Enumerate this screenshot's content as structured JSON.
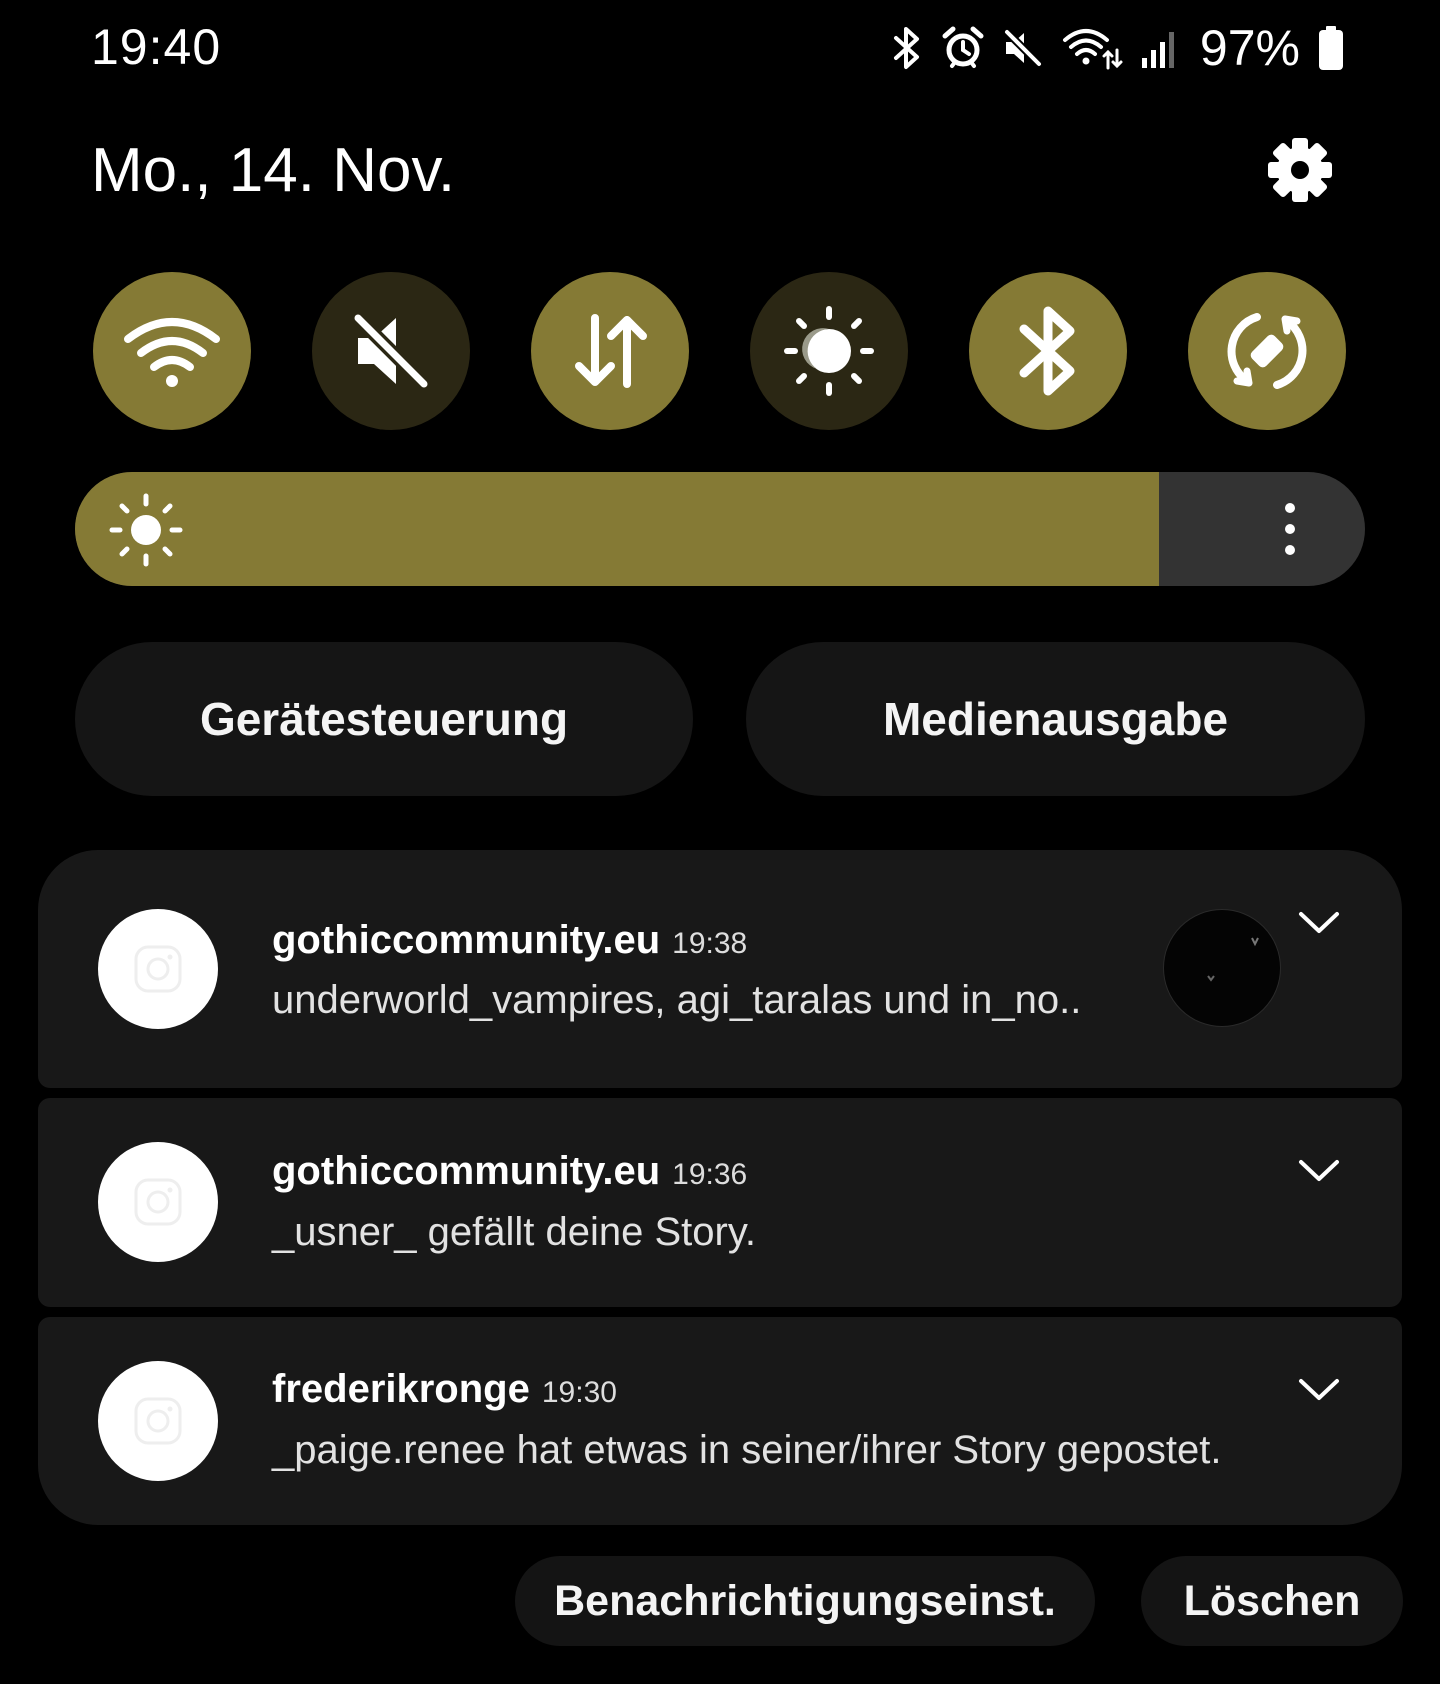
{
  "status_bar": {
    "time": "19:40",
    "battery_percent": "97%",
    "icons": [
      "bluetooth-icon",
      "alarm-icon",
      "mute-icon",
      "wifi-icon",
      "signal-icon",
      "battery-icon"
    ]
  },
  "header": {
    "date": "Mo., 14. Nov.",
    "settings_icon": "gear-icon"
  },
  "quick_tiles": [
    {
      "icon": "wifi-icon",
      "active": true
    },
    {
      "icon": "mute-icon",
      "active": false
    },
    {
      "icon": "mobile-data-icon",
      "active": true
    },
    {
      "icon": "dark-mode-icon",
      "active": false
    },
    {
      "icon": "bluetooth-icon",
      "active": true
    },
    {
      "icon": "auto-rotate-icon",
      "active": true
    }
  ],
  "brightness": {
    "level": 0.84,
    "icon": "sun-icon",
    "more_icon": "more-vertical-icon"
  },
  "shortcuts": {
    "device_control": "Gerätesteuerung",
    "media_output": "Medienausgabe"
  },
  "notifications": [
    {
      "app": "gothiccommunity.eu",
      "time": "19:38",
      "text": "underworld_vampires, agi_taralas und in_no..",
      "has_thumbnail": true
    },
    {
      "app": "gothiccommunity.eu",
      "time": "19:36",
      "text": "_usner_ gefällt deine Story.",
      "has_thumbnail": false
    },
    {
      "app": "frederikronge",
      "time": "19:30",
      "text": "_paige.renee hat etwas in seiner/ihrer Story gepostet.",
      "has_thumbnail": false
    }
  ],
  "footer": {
    "notification_settings": "Benachrichtigungseinst.",
    "clear": "Löschen"
  },
  "colors": {
    "accent": "#857a35",
    "tile_inactive": "#2b2714",
    "card": "#181818",
    "background": "#000000"
  }
}
